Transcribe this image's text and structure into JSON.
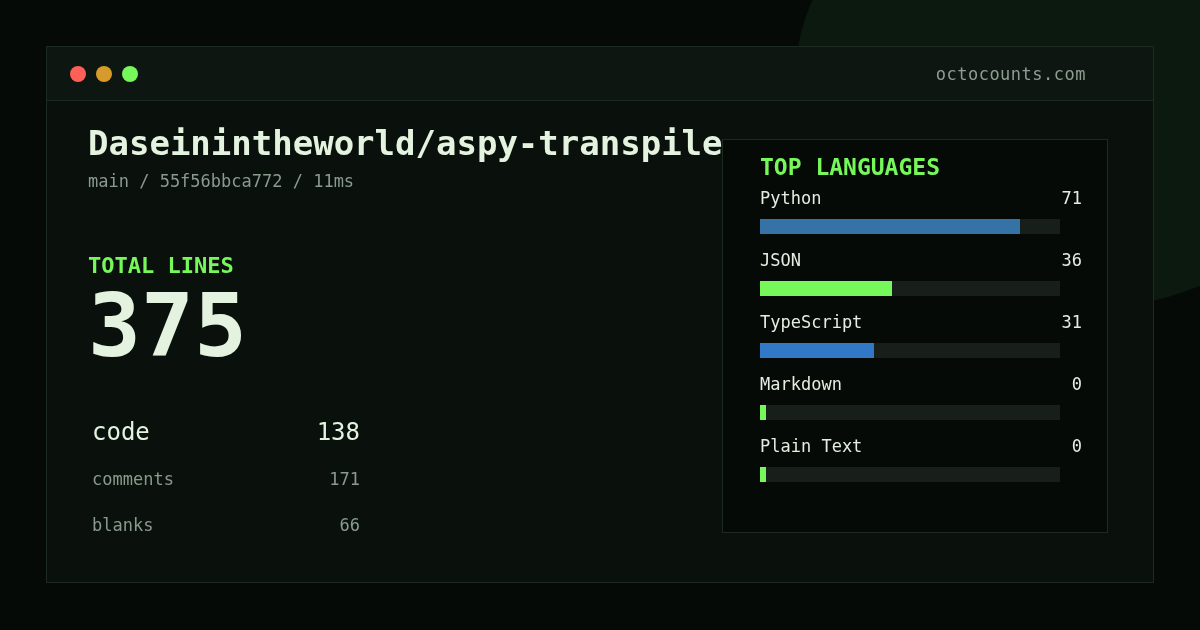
{
  "window": {
    "url": "octocounts.com"
  },
  "repo": {
    "title": "Daseinintheworld/aspy-transpile",
    "meta": "main / 55f56bbca772 / 11ms"
  },
  "total": {
    "label": "TOTAL LINES",
    "value": "375"
  },
  "breakdown": [
    {
      "kind": "primary",
      "label": "code",
      "value": "138"
    },
    {
      "kind": "secondary",
      "label": "comments",
      "value": "171"
    },
    {
      "kind": "secondary",
      "label": "blanks",
      "value": "66"
    }
  ],
  "languages": {
    "title": "TOP LANGUAGES",
    "items": [
      {
        "name": "Python",
        "value": "71",
        "level": 0.867,
        "color": "#3572a5"
      },
      {
        "name": "JSON",
        "value": "36",
        "level": 0.44,
        "color": "#76f75a"
      },
      {
        "name": "TypeScript",
        "value": "31",
        "level": 0.38,
        "color": "#3178c6"
      },
      {
        "name": "Markdown",
        "value": "0",
        "level": 0.02,
        "color": "#76f75a"
      },
      {
        "name": "Plain Text",
        "value": "0",
        "level": 0.02,
        "color": "#76f75a"
      }
    ]
  }
}
